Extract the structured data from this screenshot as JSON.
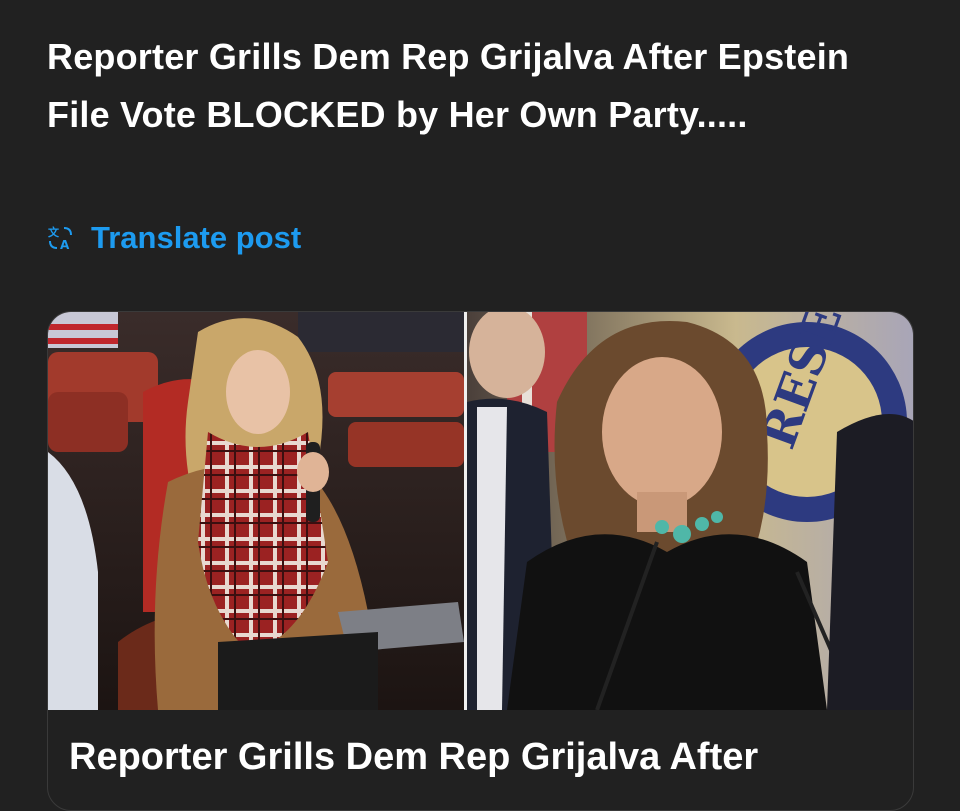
{
  "post": {
    "text": "Reporter Grills Dem Rep Grijalva After Epstein File Vote BLOCKED by Her Own Party.....",
    "translate_label": "Translate post",
    "translate_icon": "translate-icon"
  },
  "card": {
    "title": "Reporter Grills Dem Rep Grijalva After",
    "left_image": "reporter-with-microphone",
    "right_image": "congresswoman-at-podium"
  },
  "colors": {
    "background": "#212121",
    "link": "#1d9bf0",
    "text": "#ffffff"
  }
}
